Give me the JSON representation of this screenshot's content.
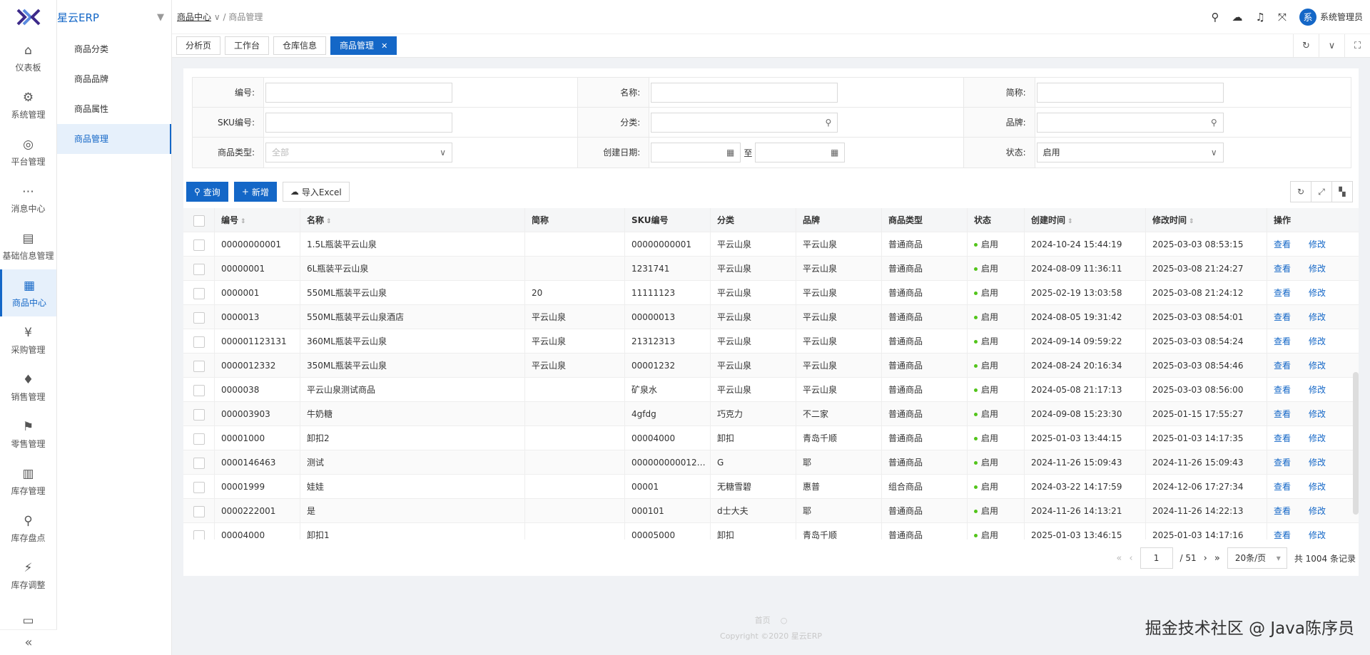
{
  "brand": {
    "name": "星云ERP"
  },
  "rail": [
    {
      "label": "仪表板",
      "icon": "⌂",
      "icon_name": "home-icon"
    },
    {
      "label": "系统管理",
      "icon": "⚙",
      "icon_name": "gear-icon"
    },
    {
      "label": "平台管理",
      "icon": "◎",
      "icon_name": "globe-icon"
    },
    {
      "label": "消息中心",
      "icon": "⋯",
      "icon_name": "message-icon"
    },
    {
      "label": "基础信息管理",
      "icon": "▤",
      "icon_name": "document-icon"
    },
    {
      "label": "商品中心",
      "icon": "▦",
      "icon_name": "grid-icon"
    },
    {
      "label": "采购管理",
      "icon": "¥",
      "icon_name": "yen-icon"
    },
    {
      "label": "销售管理",
      "icon": "♦",
      "icon_name": "bell-icon"
    },
    {
      "label": "零售管理",
      "icon": "⚑",
      "icon_name": "flag-icon"
    },
    {
      "label": "库存管理",
      "icon": "▥",
      "icon_name": "clipboard-icon"
    },
    {
      "label": "库存盘点",
      "icon": "⚲",
      "icon_name": "magnifier-icon"
    },
    {
      "label": "库存调整",
      "icon": "⚡",
      "icon_name": "lightning-icon"
    },
    {
      "label": "",
      "icon": "▭",
      "icon_name": "card-icon"
    }
  ],
  "subnav": [
    "商品分类",
    "商品品牌",
    "商品属性",
    "商品管理"
  ],
  "breadcrumb": {
    "parent": "商品中心",
    "sep": "∨ /",
    "current": "商品管理"
  },
  "user": {
    "avatar": "系",
    "name": "系统管理员"
  },
  "tabs": [
    "分析页",
    "工作台",
    "仓库信息",
    "商品管理"
  ],
  "form": {
    "code": "编号:",
    "name": "名称:",
    "short": "简称:",
    "sku": "SKU编号:",
    "category": "分类:",
    "brand": "品牌:",
    "goods_type": "商品类型:",
    "goods_type_value": "全部",
    "created": "创建日期:",
    "to": "至",
    "status": "状态:",
    "status_value": "启用"
  },
  "buttons": {
    "query": "查询",
    "add": "新增",
    "import": "导入Excel"
  },
  "columns": [
    "编号",
    "名称",
    "简称",
    "SKU编号",
    "分类",
    "品牌",
    "商品类型",
    "状态",
    "创建时间",
    "修改时间",
    "操作"
  ],
  "rows": [
    [
      "00000000001",
      "1.5L瓶装平云山泉",
      "",
      "00000000001",
      "平云山泉",
      "平云山泉",
      "普通商品",
      "启用",
      "2024-10-24 15:44:19",
      "2025-03-03 08:53:15"
    ],
    [
      "00000001",
      "6L瓶装平云山泉",
      "",
      "1231741",
      "平云山泉",
      "平云山泉",
      "普通商品",
      "启用",
      "2024-08-09 11:36:11",
      "2025-03-08 21:24:27"
    ],
    [
      "0000001",
      "550ML瓶装平云山泉",
      "20",
      "11111123",
      "平云山泉",
      "平云山泉",
      "普通商品",
      "启用",
      "2025-02-19 13:03:58",
      "2025-03-08 21:24:12"
    ],
    [
      "0000013",
      "550ML瓶装平云山泉酒店",
      "平云山泉",
      "00000013",
      "平云山泉",
      "平云山泉",
      "普通商品",
      "启用",
      "2024-08-05 19:31:42",
      "2025-03-03 08:54:01"
    ],
    [
      "000001123131",
      "360ML瓶装平云山泉",
      "平云山泉",
      "21312313",
      "平云山泉",
      "平云山泉",
      "普通商品",
      "启用",
      "2024-09-14 09:59:22",
      "2025-03-03 08:54:24"
    ],
    [
      "0000012332",
      "350ML瓶装平云山泉",
      "平云山泉",
      "00001232",
      "平云山泉",
      "平云山泉",
      "普通商品",
      "启用",
      "2024-08-24 20:16:34",
      "2025-03-03 08:54:46"
    ],
    [
      "0000038",
      "平云山泉测试商品",
      "",
      "矿泉水",
      "平云山泉",
      "平云山泉",
      "普通商品",
      "启用",
      "2024-05-08 21:17:13",
      "2025-03-03 08:56:00"
    ],
    [
      "000003903",
      "牛奶糖",
      "",
      "4gfdg",
      "巧克力",
      "不二家",
      "普通商品",
      "启用",
      "2024-09-08 15:23:30",
      "2025-01-15 17:55:27"
    ],
    [
      "00001000",
      "卸扣2",
      "",
      "00004000",
      "卸扣",
      "青岛千顺",
      "普通商品",
      "启用",
      "2025-01-03 13:44:15",
      "2025-01-03 14:17:35"
    ],
    [
      "0000146463",
      "测试",
      "",
      "0000000000122...",
      "G",
      "耶",
      "普通商品",
      "启用",
      "2024-11-26 15:09:43",
      "2024-11-26 15:09:43"
    ],
    [
      "00001999",
      "娃娃",
      "",
      "00001",
      "无糖雪碧",
      "惠普",
      "组合商品",
      "启用",
      "2024-03-22 14:17:59",
      "2024-12-06 17:27:34"
    ],
    [
      "0000222001",
      "是",
      "",
      "000101",
      "d士大夫",
      "耶",
      "普通商品",
      "启用",
      "2024-11-26 14:13:21",
      "2024-11-26 14:22:13"
    ],
    [
      "00004000",
      "卸扣1",
      "",
      "00005000",
      "卸扣",
      "青岛千顺",
      "普通商品",
      "启用",
      "2025-01-03 13:46:15",
      "2025-01-03 14:17:16"
    ]
  ],
  "actions": {
    "view": "查看",
    "edit": "修改"
  },
  "pager": {
    "page": "1",
    "total_pages": "/ 51",
    "size": "20条/页",
    "total": "共 1004 条记录"
  },
  "footer": {
    "links": "首页",
    "copyright": "Copyright ©2020 星云ERP"
  },
  "watermark": "掘金技术社区 @ Java陈序员"
}
